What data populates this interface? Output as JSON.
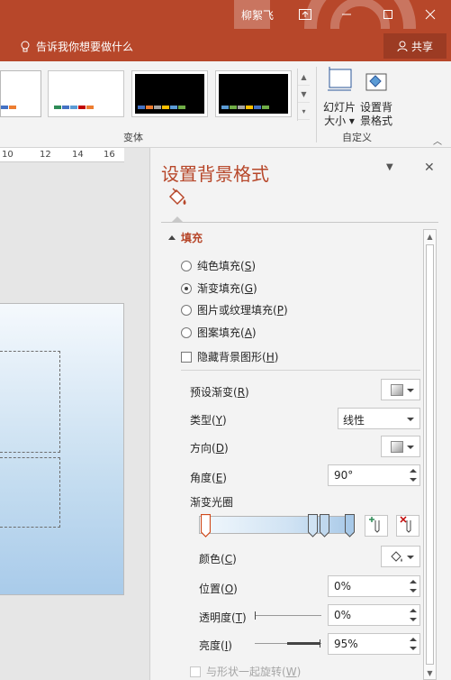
{
  "titlebar": {
    "user": "柳絮飞",
    "colors": {
      "accent": "#b7472a"
    }
  },
  "tellme": {
    "icon": "lightbulb-icon",
    "text": "告诉我你想要做什么"
  },
  "share": {
    "label": "共享",
    "icon": "person-icon"
  },
  "ribbon": {
    "variants_label": "变体",
    "customize_label": "自定义",
    "slide_size_line1": "幻灯片",
    "slide_size_line2": "大小 ▾",
    "format_bg_line1": "设置背",
    "format_bg_line2": "景格式"
  },
  "ruler": [
    "10",
    "12",
    "14",
    "16"
  ],
  "pane": {
    "title": "设置背景格式",
    "section": "填充",
    "fill_options": [
      {
        "label": "纯色填充(",
        "key": "S",
        "selected": false
      },
      {
        "label": "渐变填充(",
        "key": "G",
        "selected": true
      },
      {
        "label": "图片或纹理填充(",
        "key": "P",
        "selected": false
      },
      {
        "label": "图案填充(",
        "key": "A",
        "selected": false
      }
    ],
    "hide_bg": {
      "label": "隐藏背景图形(",
      "key": "H"
    },
    "preset_label": "预设渐变(",
    "preset_key": "R",
    "type_label": "类型(",
    "type_key": "Y",
    "type_value": "线性",
    "direction_label": "方向(",
    "direction_key": "D",
    "angle_label": "角度(",
    "angle_key": "E",
    "angle_value": "90°",
    "stops_label": "渐变光圈",
    "color_label": "颜色(",
    "color_key": "C",
    "position_label": "位置(",
    "position_key": "O",
    "position_value": "0%",
    "transparency_label": "透明度(",
    "transparency_key": "T",
    "transparency_value": "0%",
    "brightness_label": "亮度(",
    "brightness_key": "I",
    "brightness_value": "95%",
    "rotate_label": "与形状一起旋转(",
    "rotate_key": "W"
  }
}
